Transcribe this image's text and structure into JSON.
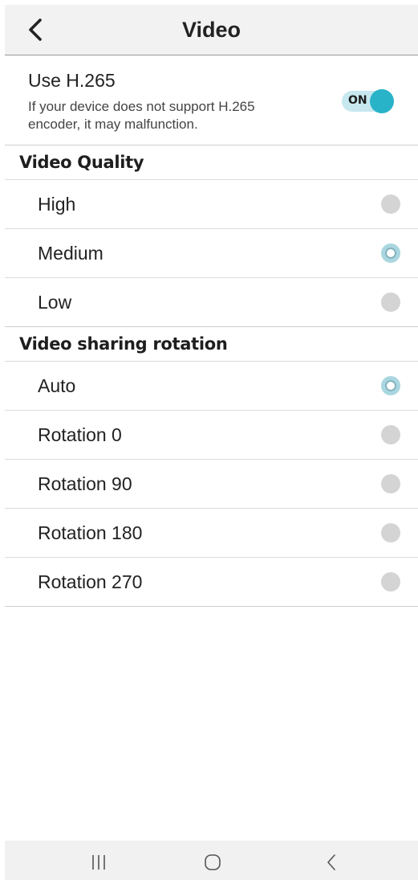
{
  "header": {
    "title": "Video",
    "back_icon": "chevron-left-icon"
  },
  "h265": {
    "title": "Use H.265",
    "description": "If your device does not support H.265 encoder, it may malfunction.",
    "toggle_label": "ON",
    "toggle_state": true
  },
  "quality": {
    "header": "Video Quality",
    "options": [
      {
        "label": "High",
        "selected": false
      },
      {
        "label": "Medium",
        "selected": true
      },
      {
        "label": "Low",
        "selected": false
      }
    ]
  },
  "rotation": {
    "header": "Video sharing rotation",
    "options": [
      {
        "label": "Auto",
        "selected": true
      },
      {
        "label": "Rotation 0",
        "selected": false
      },
      {
        "label": "Rotation 90",
        "selected": false
      },
      {
        "label": "Rotation 180",
        "selected": false
      },
      {
        "label": "Rotation 270",
        "selected": false
      }
    ]
  },
  "navbar": {
    "recents_icon": "recents-icon",
    "home_icon": "home-icon",
    "back_icon": "back-icon"
  },
  "colors": {
    "accent": "#29b3c9",
    "header_bg": "#f2f2f2",
    "radio_off": "#d4d4d4"
  }
}
